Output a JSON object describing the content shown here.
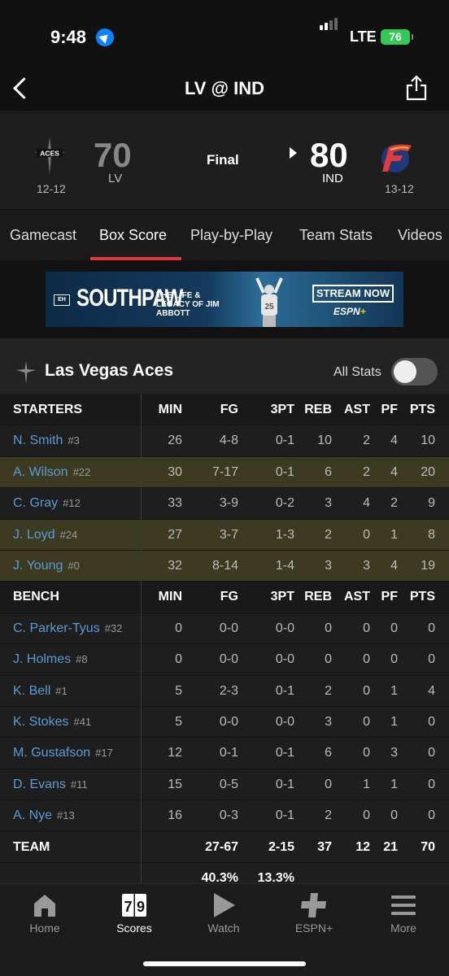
{
  "status": {
    "time": "9:48",
    "network": "LTE",
    "battery": "76"
  },
  "header": {
    "title": "LV @ IND"
  },
  "game": {
    "away": {
      "logo_text": "ACES",
      "score": "70",
      "abbr": "LV",
      "record": "12-12"
    },
    "home": {
      "score": "80",
      "abbr": "IND",
      "record": "13-12"
    },
    "status": "Final"
  },
  "tabs": [
    "Gamecast",
    "Box Score",
    "Play-by-Play",
    "Team Stats",
    "Videos"
  ],
  "ad": {
    "box": "EH",
    "brand": "SOUTHPAW",
    "tagline": "THE LIFE & LEGACY OF JIM ABBOTT",
    "jersey": "25",
    "cta": "STREAM NOW",
    "network": "ESPN",
    "network_plus": "+"
  },
  "boxscore": {
    "team_name": "Las Vegas Aces",
    "all_stats_label": "All Stats",
    "columns": [
      "MIN",
      "FG",
      "3PT",
      "REB",
      "AST",
      "PF",
      "PTS"
    ],
    "starters_label": "STARTERS",
    "bench_label": "BENCH",
    "starters": [
      {
        "name": "N. Smith",
        "num": "#3",
        "stats": [
          "26",
          "4-8",
          "0-1",
          "10",
          "2",
          "4",
          "10"
        ]
      },
      {
        "name": "A. Wilson",
        "num": "#22",
        "stats": [
          "30",
          "7-17",
          "0-1",
          "6",
          "2",
          "4",
          "20"
        ]
      },
      {
        "name": "C. Gray",
        "num": "#12",
        "stats": [
          "33",
          "3-9",
          "0-2",
          "3",
          "4",
          "2",
          "9"
        ]
      },
      {
        "name": "J. Loyd",
        "num": "#24",
        "stats": [
          "27",
          "3-7",
          "1-3",
          "2",
          "0",
          "1",
          "8"
        ]
      },
      {
        "name": "J. Young",
        "num": "#0",
        "stats": [
          "32",
          "8-14",
          "1-4",
          "3",
          "3",
          "4",
          "19"
        ]
      }
    ],
    "bench": [
      {
        "name": "C. Parker-Tyus",
        "num": "#32",
        "stats": [
          "0",
          "0-0",
          "0-0",
          "0",
          "0",
          "0",
          "0"
        ]
      },
      {
        "name": "J. Holmes",
        "num": "#8",
        "stats": [
          "0",
          "0-0",
          "0-0",
          "0",
          "0",
          "0",
          "0"
        ]
      },
      {
        "name": "K. Bell",
        "num": "#1",
        "stats": [
          "5",
          "2-3",
          "0-1",
          "2",
          "0",
          "1",
          "4"
        ]
      },
      {
        "name": "K. Stokes",
        "num": "#41",
        "stats": [
          "5",
          "0-0",
          "0-0",
          "3",
          "0",
          "1",
          "0"
        ]
      },
      {
        "name": "M. Gustafson",
        "num": "#17",
        "stats": [
          "12",
          "0-1",
          "0-1",
          "6",
          "0",
          "3",
          "0"
        ]
      },
      {
        "name": "D. Evans",
        "num": "#11",
        "stats": [
          "15",
          "0-5",
          "0-1",
          "0",
          "1",
          "1",
          "0"
        ]
      },
      {
        "name": "A. Nye",
        "num": "#13",
        "stats": [
          "16",
          "0-3",
          "0-1",
          "2",
          "0",
          "0",
          "0"
        ]
      }
    ],
    "team": {
      "label": "TEAM",
      "stats": [
        "",
        "27-67",
        "2-15",
        "37",
        "12",
        "21",
        "70"
      ]
    },
    "pct": [
      "",
      "40.3%",
      "13.3%",
      "",
      "",
      "",
      ""
    ]
  },
  "nav": [
    {
      "label": "Home",
      "icon": "home-icon"
    },
    {
      "label": "Scores",
      "icon": "scores-icon",
      "glyph": "7|9"
    },
    {
      "label": "Watch",
      "icon": "play-icon"
    },
    {
      "label": "ESPN+",
      "icon": "plus-icon"
    },
    {
      "label": "More",
      "icon": "menu-icon"
    }
  ],
  "colors": {
    "accent": "#d93b3b",
    "player_link": "#5b9bd5",
    "highlight_row": "#3d3a22"
  }
}
